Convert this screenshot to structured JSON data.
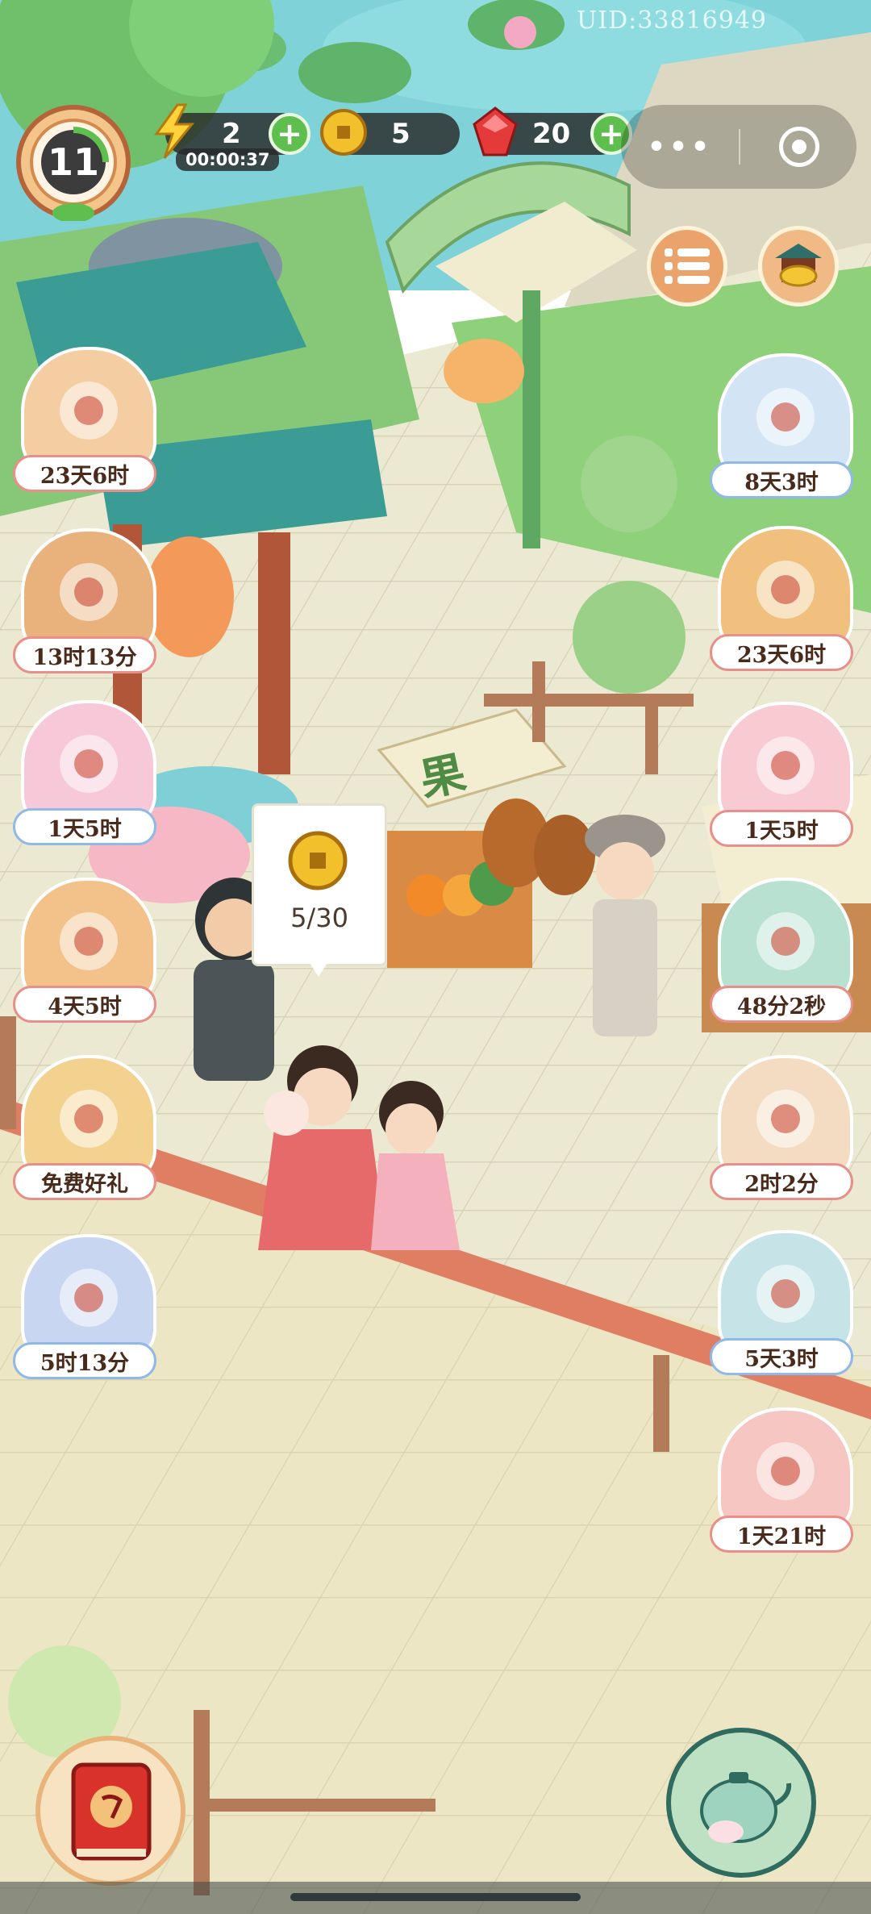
{
  "uid": "UID:33816949",
  "level": "11",
  "energy": {
    "value": "2",
    "regen_timer": "00:00:37"
  },
  "coins": {
    "value": "5"
  },
  "gems": {
    "value": "20"
  },
  "mini_program": {
    "more_glyph": "•••"
  },
  "stall": {
    "sign": "果"
  },
  "coin_bubble": {
    "progress_text": "5/30",
    "current": 5,
    "max": 30
  },
  "left_events": [
    {
      "timer": "23天6时",
      "icon": "paper-scroll-bundle-icon"
    },
    {
      "timer": "13时13分",
      "icon": "treasure-chest-icon"
    },
    {
      "timer": "1天5时",
      "icon": "flower-fan-icon"
    },
    {
      "timer": "4天5时",
      "icon": "golden-wheel-icon"
    },
    {
      "timer": "免费好礼",
      "icon": "free-gift-icon"
    },
    {
      "timer": "5时13分",
      "icon": "flying-cat-icon"
    }
  ],
  "right_events": [
    {
      "timer": "8天3时",
      "icon": "cloud-cat-icon"
    },
    {
      "timer": "23天6时",
      "icon": "red-envelope-icon"
    },
    {
      "timer": "1天5时",
      "icon": "pink-cat-icon"
    },
    {
      "timer": "48分2秒",
      "icon": "treasure-cart-icon"
    },
    {
      "timer": "2时2分",
      "icon": "cake-box-icon"
    },
    {
      "timer": "5天3时",
      "icon": "gift-cat-icon"
    },
    {
      "timer": "1天21时",
      "icon": "lady-shop-icon"
    }
  ],
  "colors": {
    "water": "#7fd2d8",
    "path": "#ebe8d0",
    "grass": "#8fd07a",
    "timer_border_red": "#e98f8a",
    "timer_border_blue": "#8fb9e8",
    "accent_green": "#5fbf4e",
    "pagoda_roof": "#3a9c95"
  }
}
